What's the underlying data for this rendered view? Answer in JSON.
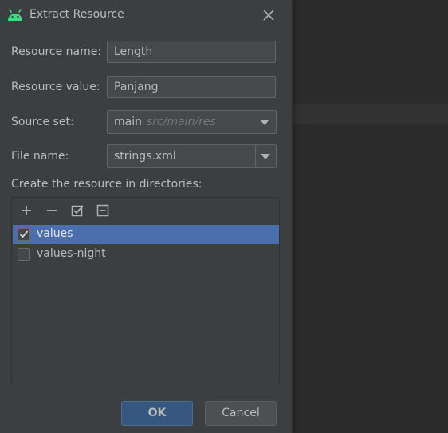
{
  "dialog": {
    "title": "Extract Resource",
    "icon": "android-icon",
    "accent": "#3ddc84"
  },
  "form": {
    "resource_name_label": "Resource name:",
    "resource_name_value": "Length",
    "resource_value_label": "Resource value:",
    "resource_value_value": "Panjang",
    "source_set_label": "Source set:",
    "source_set_value": "main",
    "source_set_hint": "src/main/res",
    "file_name_label": "File name:",
    "file_name_value": "strings.xml"
  },
  "directories": {
    "label": "Create the resource in directories:",
    "toolbar": [
      "add-icon",
      "remove-icon",
      "select-all-icon",
      "unselect-all-icon"
    ],
    "items": [
      {
        "label": "values",
        "checked": true,
        "selected": true
      },
      {
        "label": "values-night",
        "checked": false,
        "selected": false
      }
    ]
  },
  "buttons": {
    "ok": "OK",
    "cancel": "Cancel"
  }
}
